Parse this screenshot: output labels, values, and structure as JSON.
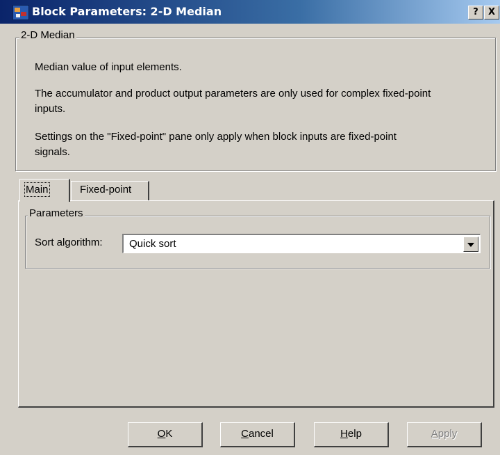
{
  "window": {
    "title": "Block Parameters: 2-D Median",
    "help_button": "?",
    "close_button": "X"
  },
  "description_group": {
    "legend": "2-D Median",
    "line1": "Median value of input elements.",
    "line2a": "The accumulator and product output parameters are only used for complex fixed-point",
    "line2b": "inputs.",
    "line3a": "Settings on the \"Fixed-point\" pane only apply when block inputs are fixed-point",
    "line3b": "signals."
  },
  "tabs": [
    {
      "label": "Main",
      "active": true
    },
    {
      "label": "Fixed-point",
      "active": false
    }
  ],
  "parameters_group": {
    "legend": "Parameters",
    "sort_algorithm_label": "Sort algorithm:",
    "sort_algorithm_value": "Quick sort"
  },
  "buttons": {
    "ok_mnemonic": "O",
    "ok_rest": "K",
    "cancel_mnemonic": "C",
    "cancel_rest": "ancel",
    "help_mnemonic": "H",
    "help_rest": "elp",
    "apply_mnemonic": "A",
    "apply_rest": "pply"
  }
}
